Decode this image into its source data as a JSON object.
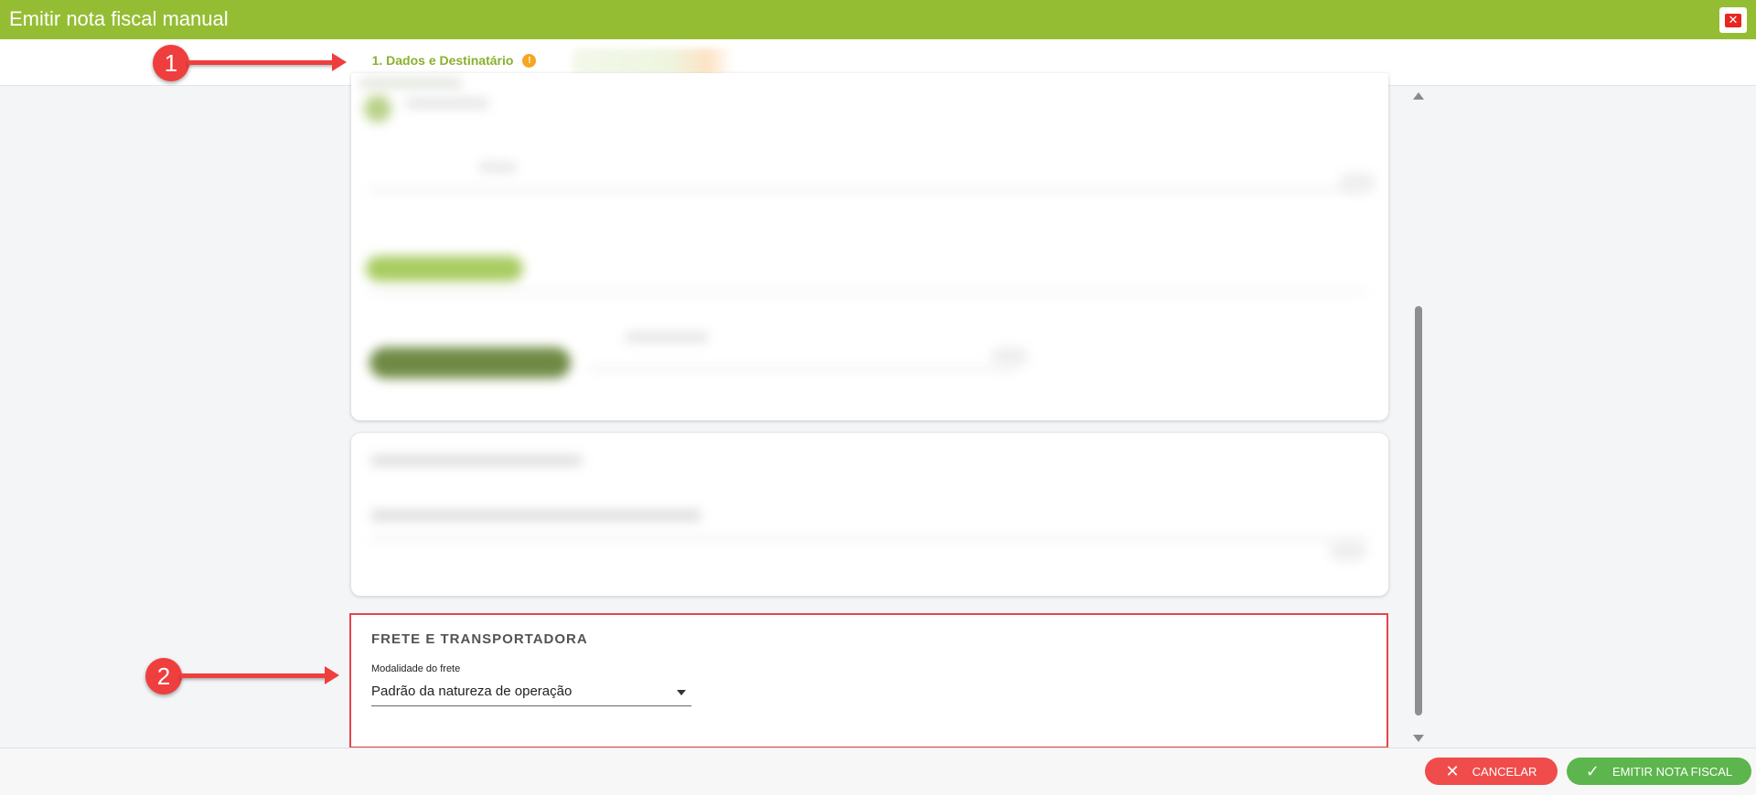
{
  "window": {
    "title": "Emitir nota fiscal manual",
    "close_symbol": "✕"
  },
  "tabs": [
    {
      "label": "1. Dados e Destinatário",
      "badge": "!",
      "active": true
    }
  ],
  "freight_section": {
    "title": "FRETE E TRANSPORTADORA",
    "field_label": "Modalidade do frete",
    "selected_value": "Padrão da natureza de operação"
  },
  "footer": {
    "cancel_label": "CANCELAR",
    "emit_label": "EMITIR NOTA FISCAL"
  },
  "annotations": {
    "marker_1": "1",
    "marker_2": "2"
  },
  "icons": {
    "close": "close-icon",
    "warning": "warning-icon",
    "dropdown": "chevron-down-icon",
    "cancel": "x-icon",
    "confirm": "check-icon"
  },
  "colors": {
    "brand_green": "#95bd34",
    "tab_text": "#8ab02d",
    "badge_orange": "#f5a623",
    "cancel_red": "#ef4c4b",
    "confirm_green": "#5db54d",
    "annotation_red": "#ef3e3e"
  }
}
